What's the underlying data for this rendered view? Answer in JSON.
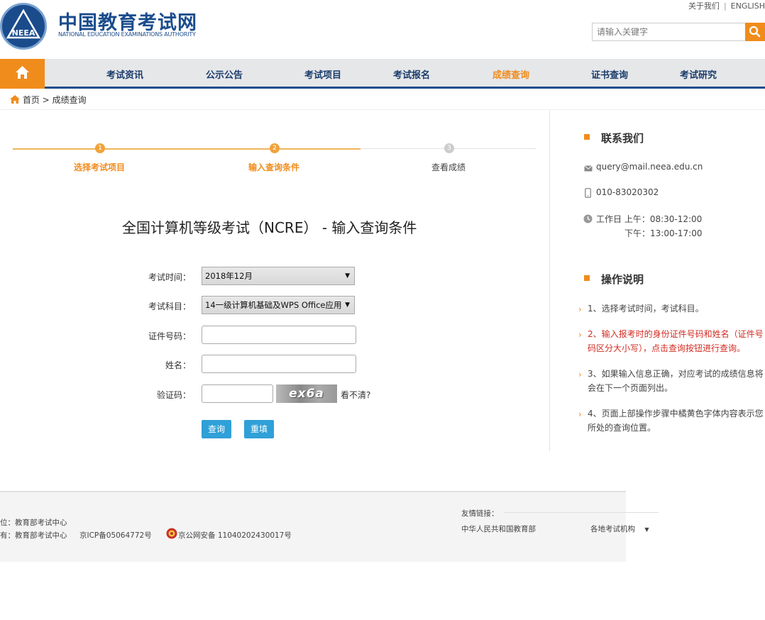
{
  "header": {
    "logo_emblem_text": "NEEA",
    "logo_cn": "中国教育考试网",
    "logo_en": "NATIONAL EDUCATION EXAMINATIONS AUTHORITY",
    "top_links": [
      "关于我们",
      "ENGLISH"
    ],
    "search_placeholder": "请输入关键字"
  },
  "nav": {
    "items": [
      {
        "label": "考试资讯",
        "active": false
      },
      {
        "label": "公示公告",
        "active": false
      },
      {
        "label": "考试项目",
        "active": false
      },
      {
        "label": "考试报名",
        "active": false
      },
      {
        "label": "成绩查询",
        "active": true
      },
      {
        "label": "证书查询",
        "active": false
      },
      {
        "label": "考试研究",
        "active": false
      }
    ]
  },
  "breadcrumb": {
    "home": "首页",
    "separator": ">",
    "current": "成绩查询"
  },
  "steps": [
    {
      "num": "1",
      "label": "选择考试项目",
      "state": "done"
    },
    {
      "num": "2",
      "label": "输入查询条件",
      "state": "current"
    },
    {
      "num": "3",
      "label": "查看成绩",
      "state": "pending"
    }
  ],
  "page_title": "全国计算机等级考试（NCRE） - 输入查询条件",
  "form": {
    "exam_time_label": "考试时间：",
    "exam_time_value": "2018年12月",
    "subject_label": "考试科目：",
    "subject_value": "14一级计算机基础及WPS Office应用",
    "id_label": "证件号码：",
    "id_value": "",
    "name_label": "姓名：",
    "name_value": "",
    "captcha_label": "验证码：",
    "captcha_value": "",
    "captcha_image_text": "ex6a",
    "captcha_refresh": "看不清?",
    "submit_label": "查询",
    "reset_label": "重填"
  },
  "sidebar": {
    "contact_title": "联系我们",
    "email": "query@mail.neea.edu.cn",
    "phone": "010-83020302",
    "hours_line1": "工作日 上午：08:30-12:00",
    "hours_line2": "下午：13:00-17:00",
    "instructions_title": "操作说明",
    "instructions": [
      {
        "text": "1、选择考试时间，考试科目。",
        "highlight": false
      },
      {
        "text": "2、输入报考时的身份证件号码和姓名（证件号码区分大小写），点击查询按钮进行查询。",
        "highlight": true
      },
      {
        "text": "3、如果输入信息正确，对应考试的成绩信息将会在下一个页面列出。",
        "highlight": false
      },
      {
        "text": "4、页面上部操作步骤中橘黄色字体内容表示您所处的查询位置。",
        "highlight": false
      }
    ]
  },
  "footer": {
    "line1": "位：教育部考试中心",
    "line2": "有：教育部考试中心",
    "icp": "京ICP备05064772号",
    "police": "京公网安备 11040202430017号",
    "links_label": "友情链接：",
    "link_moe": "中华人民共和国教育部",
    "link_local": "各地考试机构"
  },
  "colors": {
    "brand_blue": "#1a4c8c",
    "accent_orange": "#f08c1c",
    "button_blue": "#2fa0d8",
    "highlight_red": "#d22b22"
  }
}
